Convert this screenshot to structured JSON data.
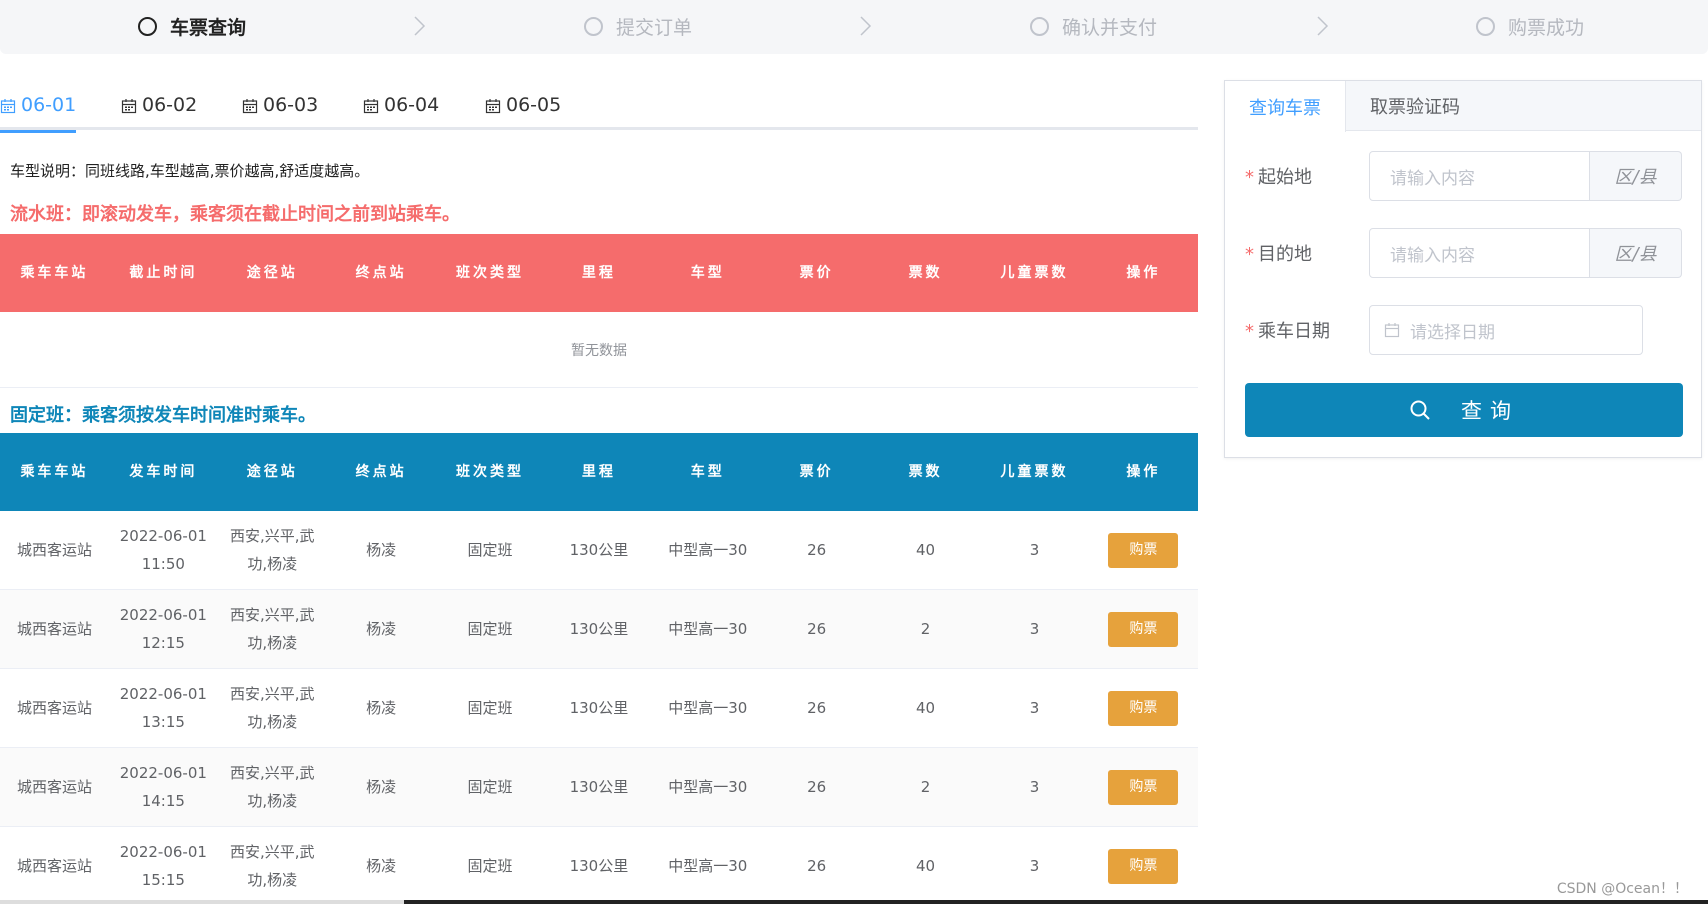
{
  "steps": [
    {
      "label": "车票查询",
      "active": true
    },
    {
      "label": "提交订单",
      "active": false
    },
    {
      "label": "确认并支付",
      "active": false
    },
    {
      "label": "购票成功",
      "active": false
    }
  ],
  "date_tabs": [
    {
      "label": "06-01",
      "active": true
    },
    {
      "label": "06-02",
      "active": false
    },
    {
      "label": "06-03",
      "active": false
    },
    {
      "label": "06-04",
      "active": false
    },
    {
      "label": "06-05",
      "active": false
    }
  ],
  "description": "车型说明：同班线路,车型越高,票价越高,舒适度越高。",
  "rolling": {
    "title": "流水班：即滚动发车，乘客须在截止时间之前到站乘车。",
    "headers": [
      "乘车车站",
      "截止时间",
      "途径站",
      "终点站",
      "班次类型",
      "里程",
      "车型",
      "票价",
      "票数",
      "儿童票数",
      "操作"
    ],
    "empty_text": "暂无数据"
  },
  "fixed": {
    "title": "固定班：乘客须按发车时间准时乘车。",
    "headers": [
      "乘车车站",
      "发车时间",
      "途径站",
      "终点站",
      "班次类型",
      "里程",
      "车型",
      "票价",
      "票数",
      "儿童票数",
      "操作"
    ],
    "rows": [
      {
        "station": "城西客运站",
        "date": "2022-06-01",
        "time": "11:50",
        "via1": "西安,兴平,武",
        "via2": "功,杨凌",
        "terminal": "杨凌",
        "type": "固定班",
        "distance": "130公里",
        "vehicle": "中型高一30",
        "price": "26",
        "tickets": "40",
        "child": "3",
        "action": "购票"
      },
      {
        "station": "城西客运站",
        "date": "2022-06-01",
        "time": "12:15",
        "via1": "西安,兴平,武",
        "via2": "功,杨凌",
        "terminal": "杨凌",
        "type": "固定班",
        "distance": "130公里",
        "vehicle": "中型高一30",
        "price": "26",
        "tickets": "2",
        "child": "3",
        "action": "购票"
      },
      {
        "station": "城西客运站",
        "date": "2022-06-01",
        "time": "13:15",
        "via1": "西安,兴平,武",
        "via2": "功,杨凌",
        "terminal": "杨凌",
        "type": "固定班",
        "distance": "130公里",
        "vehicle": "中型高一30",
        "price": "26",
        "tickets": "40",
        "child": "3",
        "action": "购票"
      },
      {
        "station": "城西客运站",
        "date": "2022-06-01",
        "time": "14:15",
        "via1": "西安,兴平,武",
        "via2": "功,杨凌",
        "terminal": "杨凌",
        "type": "固定班",
        "distance": "130公里",
        "vehicle": "中型高一30",
        "price": "26",
        "tickets": "2",
        "child": "3",
        "action": "购票"
      },
      {
        "station": "城西客运站",
        "date": "2022-06-01",
        "time": "15:15",
        "via1": "西安,兴平,武",
        "via2": "功,杨凌",
        "terminal": "杨凌",
        "type": "固定班",
        "distance": "130公里",
        "vehicle": "中型高一30",
        "price": "26",
        "tickets": "40",
        "child": "3",
        "action": "购票"
      }
    ]
  },
  "panel": {
    "tabs": [
      {
        "label": "查询车票",
        "active": true
      },
      {
        "label": "取票验证码",
        "active": false
      }
    ],
    "required_mark": "*",
    "origin_label": "起始地",
    "origin_placeholder": "请输入内容",
    "origin_append": "区/县",
    "dest_label": "目的地",
    "dest_placeholder": "请输入内容",
    "dest_append": "区/县",
    "date_label": "乘车日期",
    "date_placeholder": "请选择日期",
    "query_label": "查询"
  },
  "watermark": "CSDN @Ocean！！",
  "colors": {
    "accent": "#409eff",
    "rolling_header": "#f56c6c",
    "fixed_header": "#0e86b8",
    "buy_button": "#e6a23c"
  }
}
